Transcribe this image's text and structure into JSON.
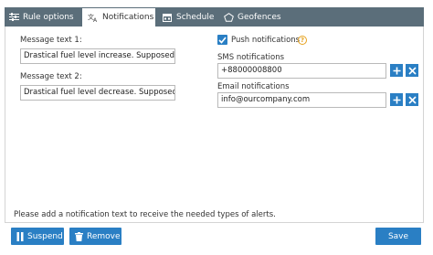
{
  "tabs": [
    {
      "label": "Rule options",
      "icon": "sliders-icon"
    },
    {
      "label": "Notifications",
      "icon": "translate-icon"
    },
    {
      "label": "Schedule",
      "icon": "calendar-icon"
    },
    {
      "label": "Geofences",
      "icon": "pentagon-icon"
    }
  ],
  "messages": {
    "label1": "Message text 1:",
    "value1": "Drastical fuel level increase. Supposed fill",
    "label2": "Message text 2:",
    "value2": "Drastical fuel level decrease. Supposed dr"
  },
  "push": {
    "label": "Push notifications",
    "checked": true,
    "help": "?"
  },
  "sms": {
    "label": "SMS notifications",
    "value": "+88000008800"
  },
  "email": {
    "label": "Email notifications",
    "value": "info@ourcompany.com"
  },
  "footer_note": "Please add a notification text to receive the needed types of alerts.",
  "buttons": {
    "suspend": "Suspend",
    "remove": "Remove",
    "save": "Save"
  },
  "colors": {
    "accent": "#2a7fc4",
    "tabbar": "#5b6e7a",
    "help": "#e6a21e"
  }
}
